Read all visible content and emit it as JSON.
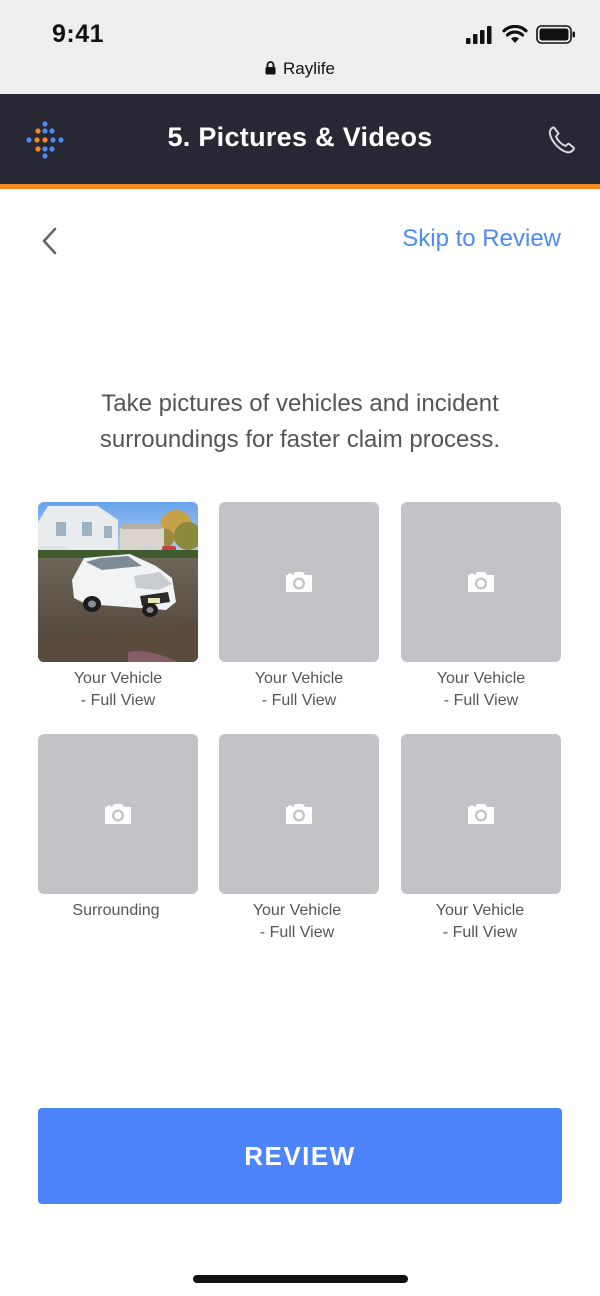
{
  "status_bar": {
    "time": "9:41",
    "url": "Raylife",
    "icons": [
      "signal-icon",
      "wifi-icon",
      "battery-icon",
      "lock-icon"
    ]
  },
  "header": {
    "title": "5. Pictures & Videos",
    "logo_icon": "raylife-logo-icon",
    "call_icon": "phone-icon",
    "accent_color": "#f5881f",
    "background_color": "#272833"
  },
  "nav": {
    "back_icon": "chevron-left-icon",
    "skip_label": "Skip to Review"
  },
  "instructions": "Take pictures of vehicles and incident surroundings for faster claim process.",
  "photos": [
    {
      "line1": "Your Vehicle",
      "line2": "- Full View",
      "has_photo": true
    },
    {
      "line1": "Your Vehicle",
      "line2": "- Full View",
      "has_photo": false
    },
    {
      "line1": "Your Vehicle",
      "line2": "- Full View",
      "has_photo": false
    },
    {
      "line1": "Surrounding",
      "line2": "",
      "has_photo": false
    },
    {
      "line1": "Your Vehicle",
      "line2": "- Full View",
      "has_photo": false
    },
    {
      "line1": "Your Vehicle",
      "line2": "- Full View",
      "has_photo": false
    }
  ],
  "review_button": {
    "label": "REVIEW",
    "color": "#4c85fb"
  }
}
